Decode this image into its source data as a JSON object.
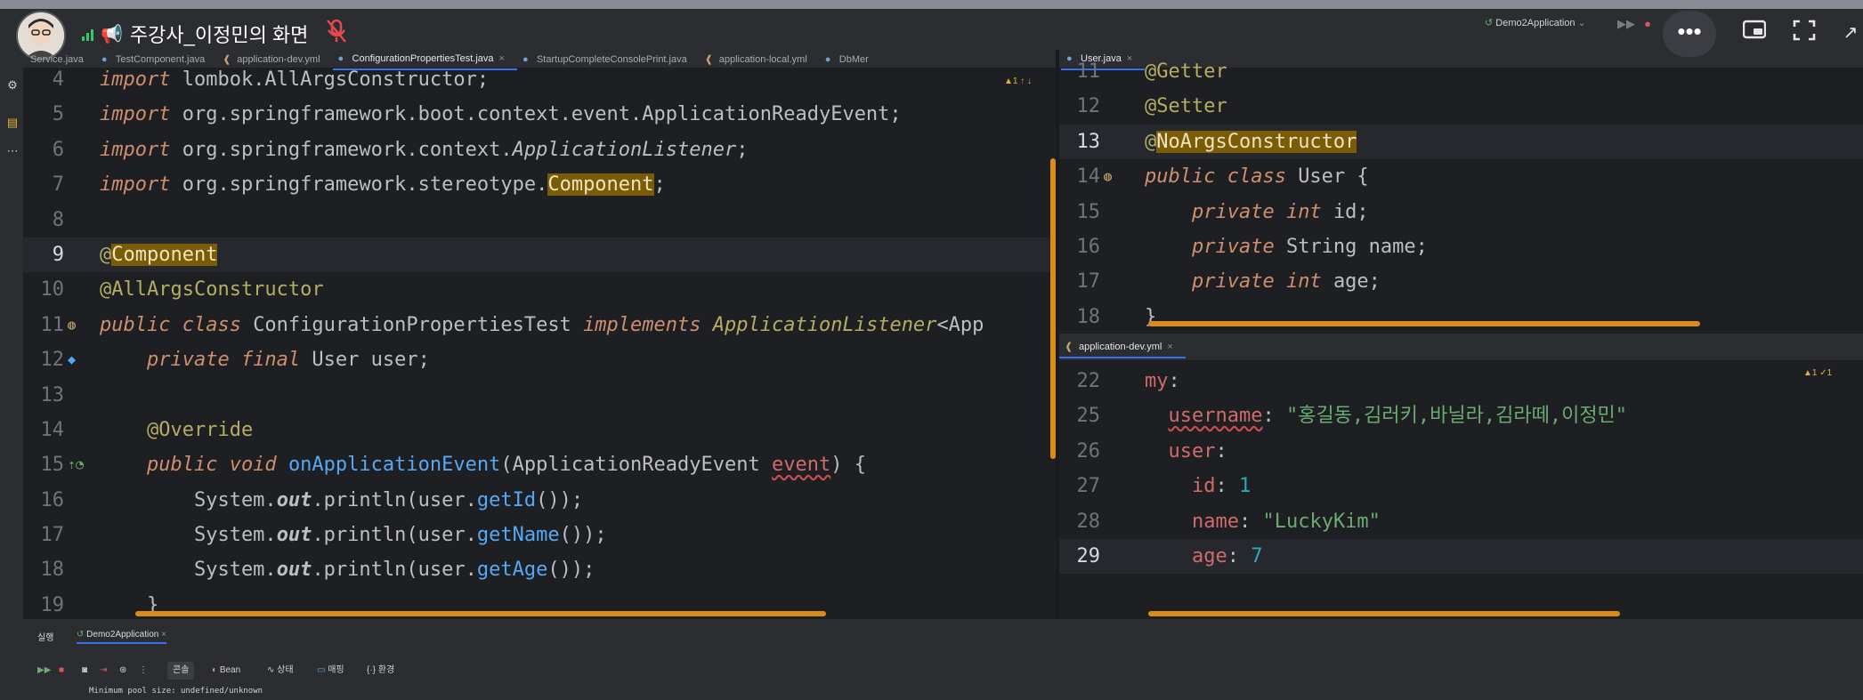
{
  "meeting": {
    "presenter_label": "주강사_이정민의 화면",
    "run_config": "Demo2Application",
    "icons": {
      "more": "more-dots-icon",
      "pip": "picture-in-picture-icon",
      "fullscreen": "fullscreen-icon",
      "mic": "mic-off-icon",
      "signal": "signal-icon"
    }
  },
  "editor_tabs": [
    {
      "label": "Service.java",
      "type": "java"
    },
    {
      "label": "TestComponent.java",
      "type": "java"
    },
    {
      "label": "application-dev.yml",
      "type": "yml"
    },
    {
      "label": "ConfigurationPropertiesTest.java",
      "type": "java",
      "active": true
    },
    {
      "label": "StartupCompleteConsolePrint.java",
      "type": "java"
    },
    {
      "label": "application-local.yml",
      "type": "yml"
    },
    {
      "label": "DbMer",
      "type": "java"
    }
  ],
  "left_editor": {
    "lines": [
      {
        "n": "4",
        "segs": [
          [
            "kw",
            "import "
          ],
          [
            "",
            "lombok.AllArgsConstructor;"
          ]
        ]
      },
      {
        "n": "5",
        "segs": [
          [
            "kw",
            "import "
          ],
          [
            "",
            "org.springframework.boot.context.event.ApplicationReadyEvent;"
          ]
        ]
      },
      {
        "n": "6",
        "segs": [
          [
            "kw",
            "import "
          ],
          [
            "",
            "org.springframework.context."
          ],
          [
            "it",
            "ApplicationListener"
          ],
          [
            "",
            ";"
          ]
        ]
      },
      {
        "n": "7",
        "segs": [
          [
            "kw",
            "import "
          ],
          [
            "",
            "org.springframework.stereotype."
          ],
          [
            "hl",
            "Component"
          ],
          [
            "",
            ";"
          ]
        ]
      },
      {
        "n": "8",
        "segs": []
      },
      {
        "n": "9",
        "cur": true,
        "segs": [
          [
            "ann",
            "@"
          ],
          [
            "hl ann",
            "Component"
          ]
        ]
      },
      {
        "n": "10",
        "segs": [
          [
            "ann",
            "@AllArgsConstructor"
          ]
        ]
      },
      {
        "n": "11",
        "segs": [
          [
            "kw",
            "public class "
          ],
          [
            "",
            "ConfigurationPropertiesTest "
          ],
          [
            "kw",
            "implements "
          ],
          [
            "ann it",
            "ApplicationListener"
          ],
          [
            "",
            "<App"
          ]
        ]
      },
      {
        "n": "12",
        "segs": [
          [
            "",
            "    "
          ],
          [
            "kw",
            "private final "
          ],
          [
            "",
            "User user;"
          ]
        ]
      },
      {
        "n": "13",
        "segs": []
      },
      {
        "n": "14",
        "segs": [
          [
            "",
            "    "
          ],
          [
            "ann",
            "@Override"
          ]
        ]
      },
      {
        "n": "15",
        "segs": [
          [
            "",
            "    "
          ],
          [
            "kw",
            "public void "
          ],
          [
            "meth",
            "onApplicationEvent"
          ],
          [
            "",
            "(ApplicationReadyEvent "
          ],
          [
            "warn-ul key",
            "event"
          ],
          [
            "",
            ") {"
          ]
        ]
      },
      {
        "n": "16",
        "segs": [
          [
            "",
            "        System."
          ],
          [
            "bi",
            "out"
          ],
          [
            "",
            ".println(user."
          ],
          [
            "meth",
            "getId"
          ],
          [
            "",
            "());"
          ]
        ]
      },
      {
        "n": "17",
        "segs": [
          [
            "",
            "        System."
          ],
          [
            "bi",
            "out"
          ],
          [
            "",
            ".println(user."
          ],
          [
            "meth",
            "getName"
          ],
          [
            "",
            "());"
          ]
        ]
      },
      {
        "n": "18",
        "segs": [
          [
            "",
            "        System."
          ],
          [
            "bi",
            "out"
          ],
          [
            "",
            ".println(user."
          ],
          [
            "meth",
            "getAge"
          ],
          [
            "",
            "());"
          ]
        ]
      },
      {
        "n": "19",
        "segs": [
          [
            "",
            "    }"
          ]
        ]
      }
    ],
    "inspection": "▲1 ↑ ↓"
  },
  "user_tab": {
    "label": "User.java"
  },
  "user_editor": {
    "lines": [
      {
        "n": "11",
        "segs": [
          [
            "ann",
            "@Getter"
          ]
        ]
      },
      {
        "n": "12",
        "segs": [
          [
            "ann",
            "@Setter"
          ]
        ]
      },
      {
        "n": "13",
        "cur": true,
        "segs": [
          [
            "ann",
            "@"
          ],
          [
            "hl ann",
            "NoArgsConstructor"
          ]
        ]
      },
      {
        "n": "14",
        "segs": [
          [
            "kw",
            "public class "
          ],
          [
            "",
            "User {"
          ]
        ]
      },
      {
        "n": "15",
        "segs": [
          [
            "",
            "    "
          ],
          [
            "kw",
            "private int "
          ],
          [
            "",
            "id;"
          ]
        ]
      },
      {
        "n": "16",
        "segs": [
          [
            "",
            "    "
          ],
          [
            "kw",
            "private "
          ],
          [
            "",
            "String name;"
          ]
        ]
      },
      {
        "n": "17",
        "segs": [
          [
            "",
            "    "
          ],
          [
            "kw",
            "private int "
          ],
          [
            "",
            "age;"
          ]
        ]
      },
      {
        "n": "18",
        "segs": [
          [
            "",
            "}"
          ]
        ]
      }
    ]
  },
  "yml_tab": {
    "label": "application-dev.yml"
  },
  "yml_editor": {
    "inspection": "▲1 ✓1",
    "lines": [
      {
        "n": "22",
        "segs": [
          [
            "key",
            "my"
          ],
          [
            "",
            ":"
          ]
        ]
      },
      {
        "n": "25",
        "segs": [
          [
            "",
            "  "
          ],
          [
            "key warn-ul",
            "username"
          ],
          [
            "",
            ": "
          ],
          [
            "str",
            "\"홍길동,김러키,바닐라,김라떼,이정민\""
          ]
        ]
      },
      {
        "n": "26",
        "segs": [
          [
            "",
            "  "
          ],
          [
            "key",
            "user"
          ],
          [
            "",
            ":"
          ]
        ]
      },
      {
        "n": "27",
        "segs": [
          [
            "",
            "    "
          ],
          [
            "key",
            "id"
          ],
          [
            "",
            ": "
          ],
          [
            "num",
            "1"
          ]
        ]
      },
      {
        "n": "28",
        "segs": [
          [
            "",
            "    "
          ],
          [
            "key",
            "name"
          ],
          [
            "",
            ": "
          ],
          [
            "str",
            "\"LuckyKim\""
          ]
        ]
      },
      {
        "n": "29",
        "cur": true,
        "segs": [
          [
            "",
            "    "
          ],
          [
            "key",
            "age"
          ],
          [
            "",
            ": "
          ],
          [
            "num",
            "7"
          ]
        ]
      }
    ]
  },
  "bottom_panel": {
    "run_label": "실행",
    "run_tab": "Demo2Application",
    "tabs": [
      "콘솔",
      "Bean",
      "상태",
      "매핑",
      "환경"
    ],
    "console_text": "Minimum pool size: undefined/unknown"
  },
  "colors": {
    "accent": "#3574f0",
    "highlight": "#7a5c06",
    "annotation_stroke": "#d98c1a",
    "keyword": "#cf8e6d",
    "string": "#6aab73"
  }
}
